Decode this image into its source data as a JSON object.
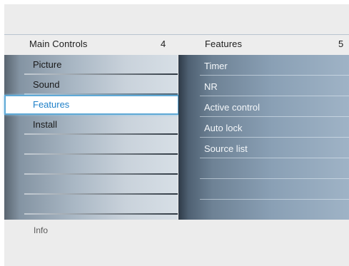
{
  "header": {
    "left_title": "Main Controls",
    "left_count": "4",
    "right_title": "Features",
    "right_count": "5"
  },
  "left_menu": {
    "items": [
      {
        "label": "Picture",
        "selected": false
      },
      {
        "label": "Sound",
        "selected": false
      },
      {
        "label": "Features",
        "selected": true
      },
      {
        "label": "Install",
        "selected": false
      },
      {
        "label": "",
        "selected": false
      },
      {
        "label": "",
        "selected": false
      },
      {
        "label": "",
        "selected": false
      },
      {
        "label": "",
        "selected": false
      }
    ]
  },
  "right_menu": {
    "items": [
      {
        "label": "Timer"
      },
      {
        "label": "NR"
      },
      {
        "label": "Active control"
      },
      {
        "label": "Auto lock"
      },
      {
        "label": "Source list"
      },
      {
        "label": ""
      },
      {
        "label": ""
      },
      {
        "label": ""
      }
    ]
  },
  "footer": {
    "info_label": "Info"
  },
  "colors": {
    "selection_border": "#5fa9d6",
    "selection_text": "#1f80c8",
    "right_panel_text": "#f4f7fa"
  }
}
